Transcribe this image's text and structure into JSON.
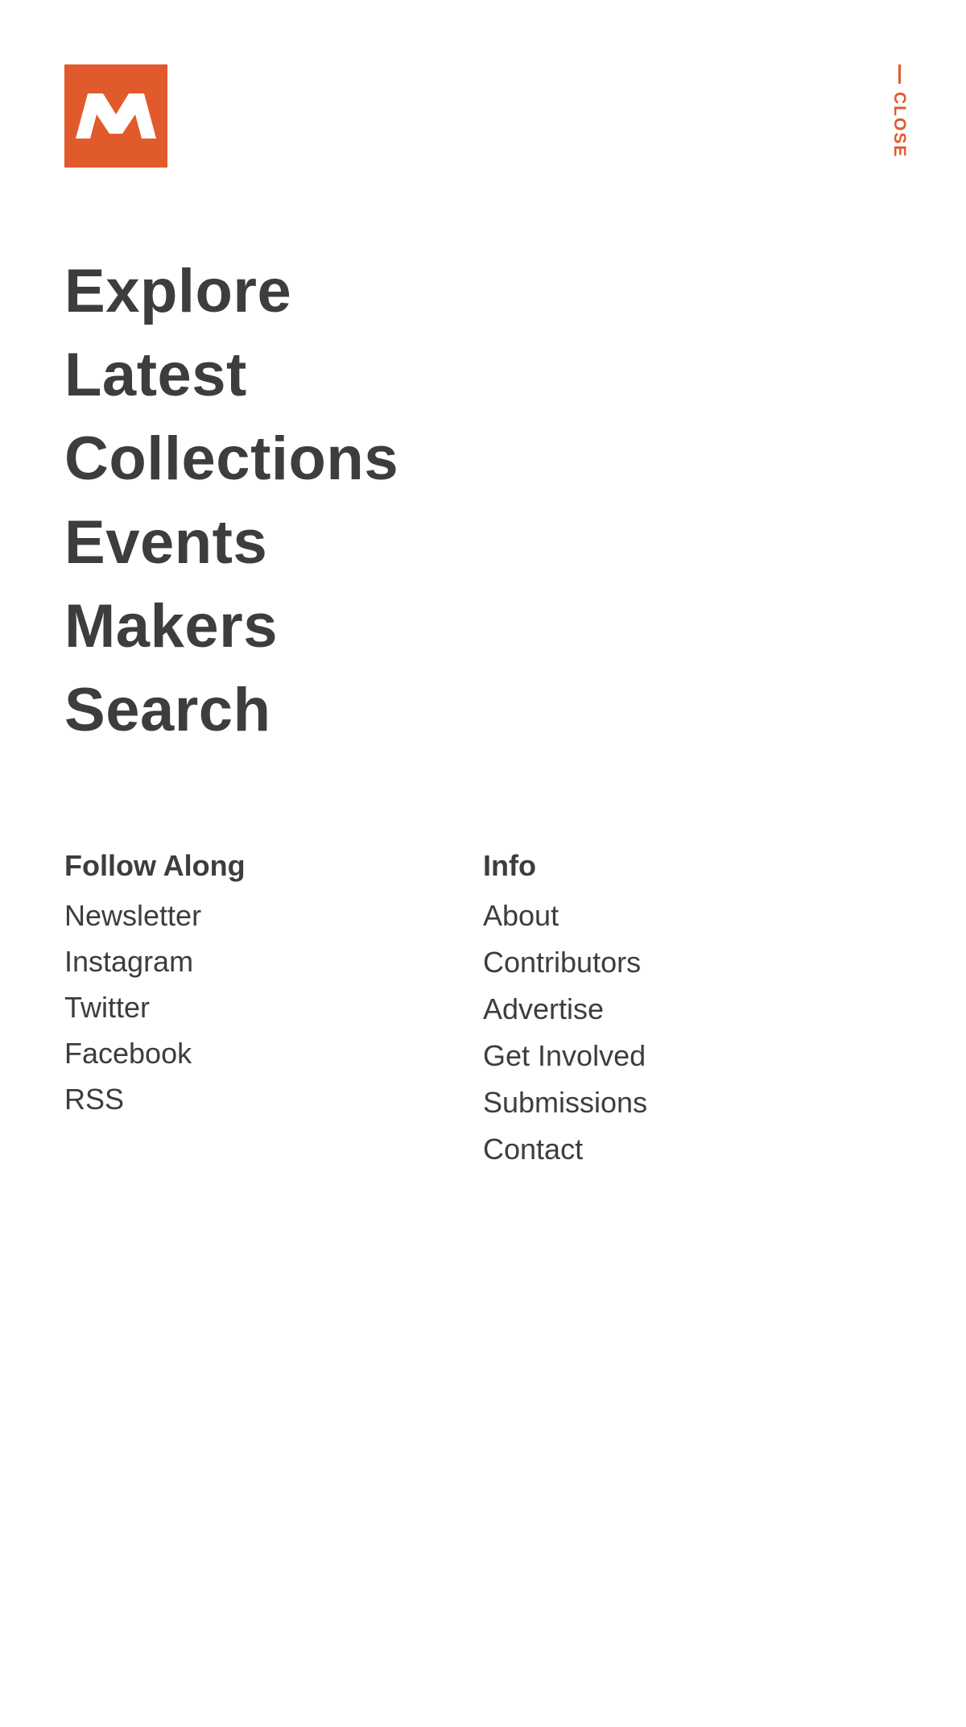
{
  "brand": {
    "logo_letter": "M",
    "logo_color": "#e15a2c"
  },
  "close": {
    "label": "CLOSE",
    "color": "#e15a2c"
  },
  "main_nav": {
    "items": [
      {
        "label": "Explore"
      },
      {
        "label": "Latest"
      },
      {
        "label": "Collections"
      },
      {
        "label": "Events"
      },
      {
        "label": "Makers"
      },
      {
        "label": "Search"
      }
    ]
  },
  "follow_along": {
    "heading": "Follow Along",
    "links": [
      {
        "label": "Newsletter"
      },
      {
        "label": "Instagram"
      },
      {
        "label": "Twitter"
      },
      {
        "label": "Facebook"
      },
      {
        "label": "RSS"
      }
    ]
  },
  "info": {
    "heading": "Info",
    "links": [
      {
        "label": "About"
      },
      {
        "label": "Contributors"
      },
      {
        "label": "Advertise"
      },
      {
        "label": "Get Involved"
      },
      {
        "label": "Submissions"
      },
      {
        "label": "Contact"
      }
    ]
  },
  "colors": {
    "accent": "#e15a2c",
    "text": "#3d3d3d",
    "background": "#ffffff"
  }
}
